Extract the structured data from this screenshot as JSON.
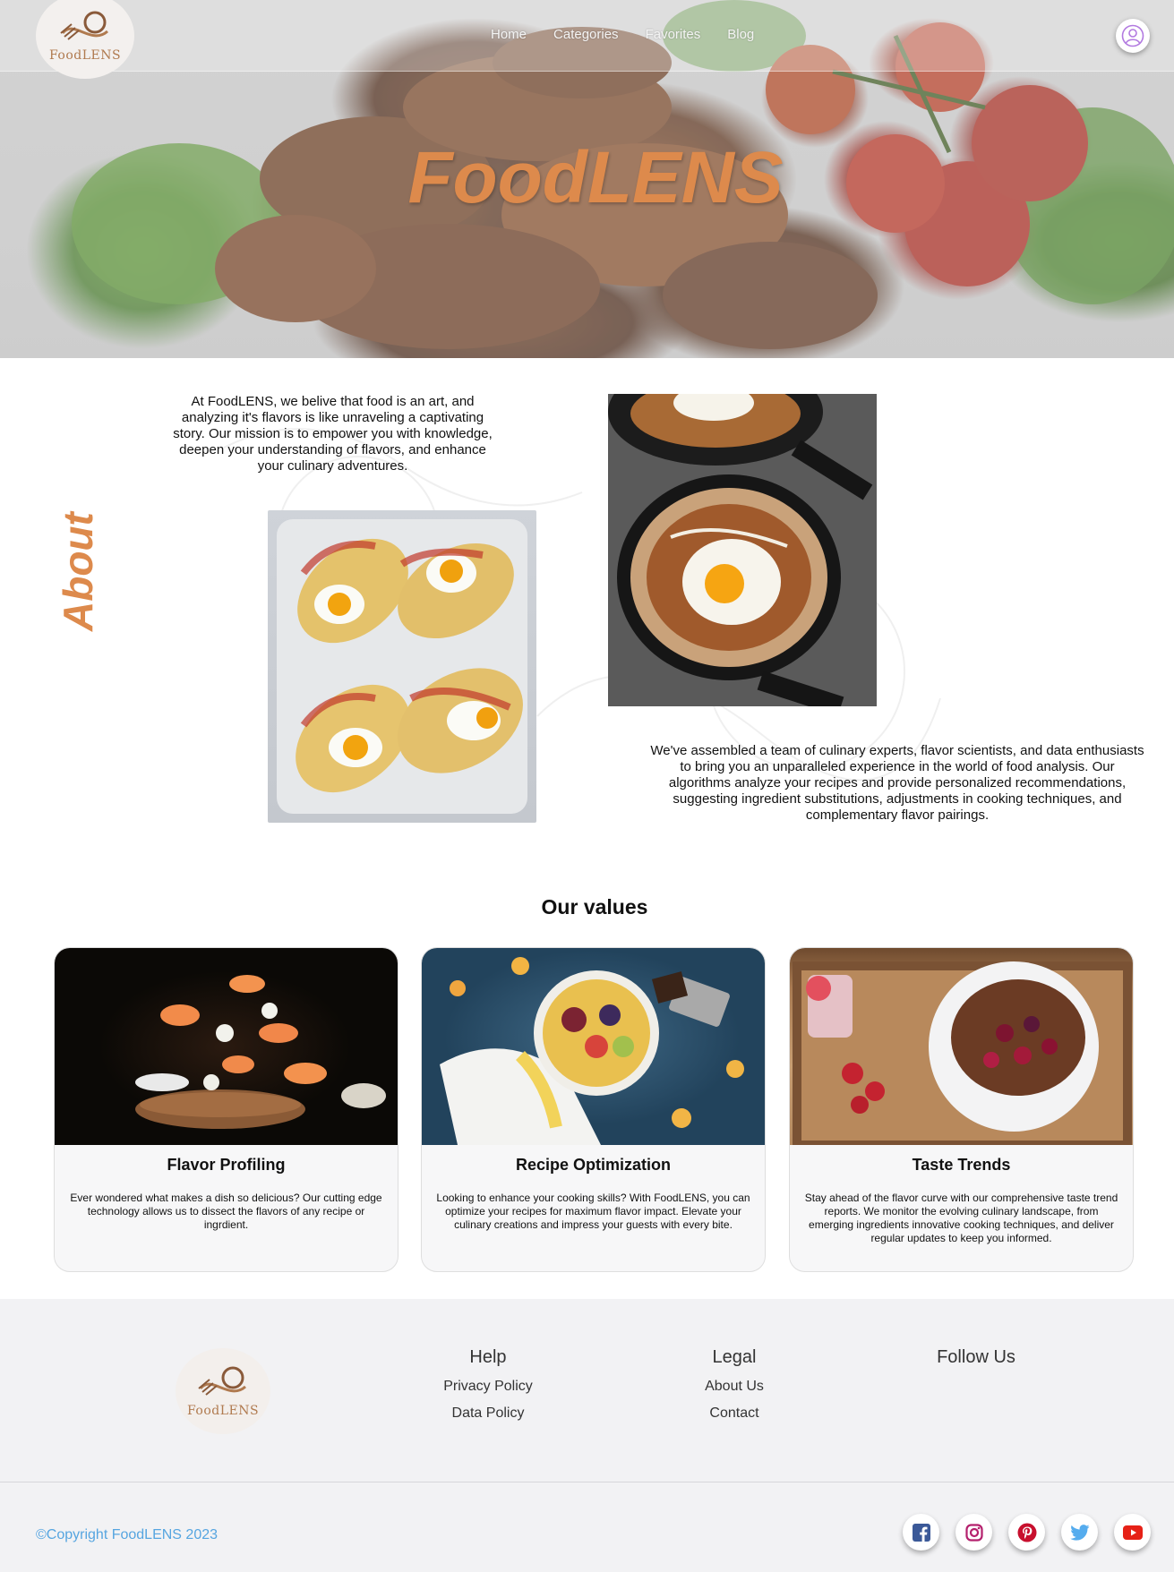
{
  "nav": {
    "logo_text": "FoodLENS",
    "links": [
      "Home",
      "Categories",
      "Favorites",
      "Blog"
    ]
  },
  "hero": {
    "title": "FoodLENS"
  },
  "about": {
    "label": "About",
    "paragraph1": "At FoodLENS, we belive that food is an art, and analyzing it's flavors is like unraveling a captivating story. Our mission is to empower you with knowledge, deepen your understanding of flavors, and enhance your culinary adventures.",
    "paragraph2": "We've assembled a team of culinary experts, flavor scientists, and data enthusiasts to bring you an unparalleled experience in the world of food analysis. Our algorithms analyze your recipes and provide personalized recommendations, suggesting ingredient substitutions, adjustments in cooking techniques, and complementary flavor pairings."
  },
  "values": {
    "title": "Our values",
    "cards": [
      {
        "title": "Flavor Profiling",
        "text": "Ever wondered what makes a dish so delicious? Our cutting edge technology allows us to dissect the flavors of any recipe or ingrdient."
      },
      {
        "title": "Recipe Optimization",
        "text": "Looking to enhance your cooking skills? With FoodLENS, you can optimize your recipes for maximum flavor impact. Elevate your culinary creations and impress your guests with every bite."
      },
      {
        "title": "Taste Trends",
        "text": "Stay ahead of the flavor curve with our comprehensive taste trend reports. We monitor the evolving culinary landscape, from emerging ingredients innovative cooking techniques, and deliver regular updates to keep you informed."
      }
    ]
  },
  "footer": {
    "logo_text": "FoodLENS",
    "help": {
      "heading": "Help",
      "links": [
        "Privacy Policy",
        "Data Policy"
      ]
    },
    "legal": {
      "heading": "Legal",
      "links": [
        "About Us",
        "Contact"
      ]
    },
    "follow": {
      "heading": "Follow Us"
    },
    "copyright": "©Copyright FoodLENS 2023",
    "socials": [
      "facebook-icon",
      "instagram-icon",
      "pinterest-icon",
      "twitter-icon",
      "youtube-icon"
    ]
  },
  "colors": {
    "accent": "#dd8a4c",
    "link": "#56a5e0",
    "footer_bg": "#f2f2f4"
  }
}
